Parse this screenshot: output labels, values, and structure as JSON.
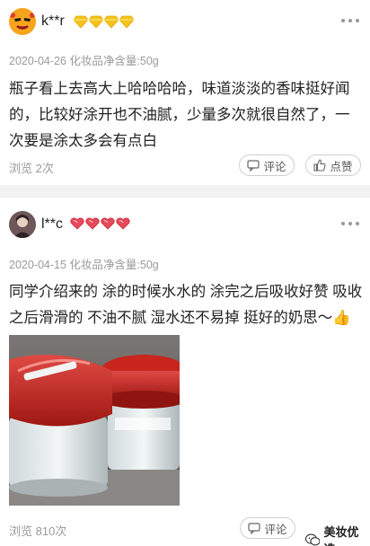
{
  "comments": [
    {
      "username": "k**r",
      "badge_icon": "diamond-icon",
      "badge_count": 4,
      "date_meta": "2020-04-26 化妆品净含量:50g",
      "text": "瓶子看上去高大上哈哈哈哈，味道淡淡的香味挺好闻的，比较好涂开也不油腻，少量多次就很自然了，一次要是涂太多会有点白",
      "views": "浏览 2次",
      "comment_label": "评论",
      "like_label": "点赞"
    },
    {
      "username": "l**c",
      "badge_icon": "heart-icon",
      "badge_count": 4,
      "date_meta": "2020-04-15 化妆品净含量:50g",
      "text": "同学介绍来的 涂的时候水水的 涂完之后吸收好赞 吸收之后滑滑的 不油不腻 湿水还不易掉 挺好的奶思～👍",
      "views": "浏览 810次",
      "comment_label": "评论",
      "like_label": "点赞"
    }
  ],
  "watermark": {
    "label": "美妆优选"
  },
  "colors": {
    "diamond": "#f6c21b",
    "heart": "#e8495c",
    "separator": "#f2f2f2",
    "meta_text": "#9a9a9a"
  }
}
